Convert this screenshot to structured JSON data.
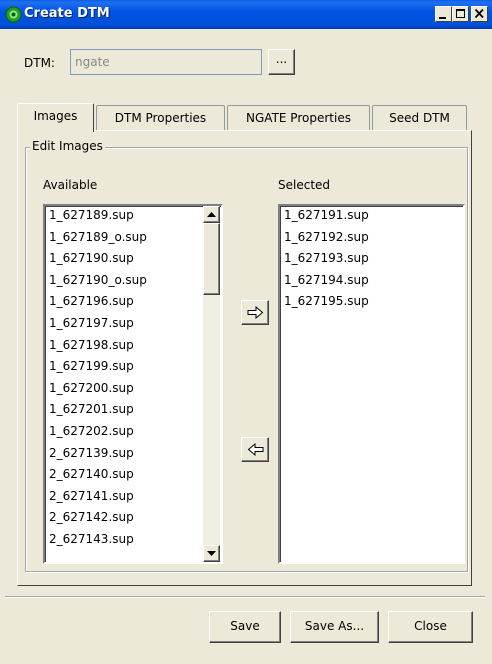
{
  "window": {
    "title": "Create DTM",
    "controls": [
      "minimize-icon",
      "maximize-icon",
      "close-icon"
    ]
  },
  "dtm": {
    "label": "DTM:",
    "value": "ngate",
    "browse_label": "..."
  },
  "tabs": [
    {
      "label": "Images",
      "active": true
    },
    {
      "label": "DTM Properties",
      "active": false
    },
    {
      "label": "NGATE Properties",
      "active": false
    },
    {
      "label": "Seed DTM",
      "active": false
    }
  ],
  "edit_images": {
    "group_title": "Edit Images",
    "available_label": "Available",
    "selected_label": "Selected",
    "available": [
      "1_627189.sup",
      "1_627189_o.sup",
      "1_627190.sup",
      "1_627190_o.sup",
      "1_627196.sup",
      "1_627197.sup",
      "1_627198.sup",
      "1_627199.sup",
      "1_627200.sup",
      "1_627201.sup",
      "1_627202.sup",
      "2_627139.sup",
      "2_627140.sup",
      "2_627141.sup",
      "2_627142.sup",
      "2_627143.sup"
    ],
    "selected": [
      "1_627191.sup",
      "1_627192.sup",
      "1_627193.sup",
      "1_627194.sup",
      "1_627195.sup"
    ],
    "add_icon": "arrow-right-icon",
    "remove_icon": "arrow-left-icon"
  },
  "buttons": {
    "save": "Save",
    "save_as": "Save As...",
    "close": "Close"
  },
  "colors": {
    "titlebar": "#0054e3",
    "dialog_bg": "#ece9d8"
  }
}
